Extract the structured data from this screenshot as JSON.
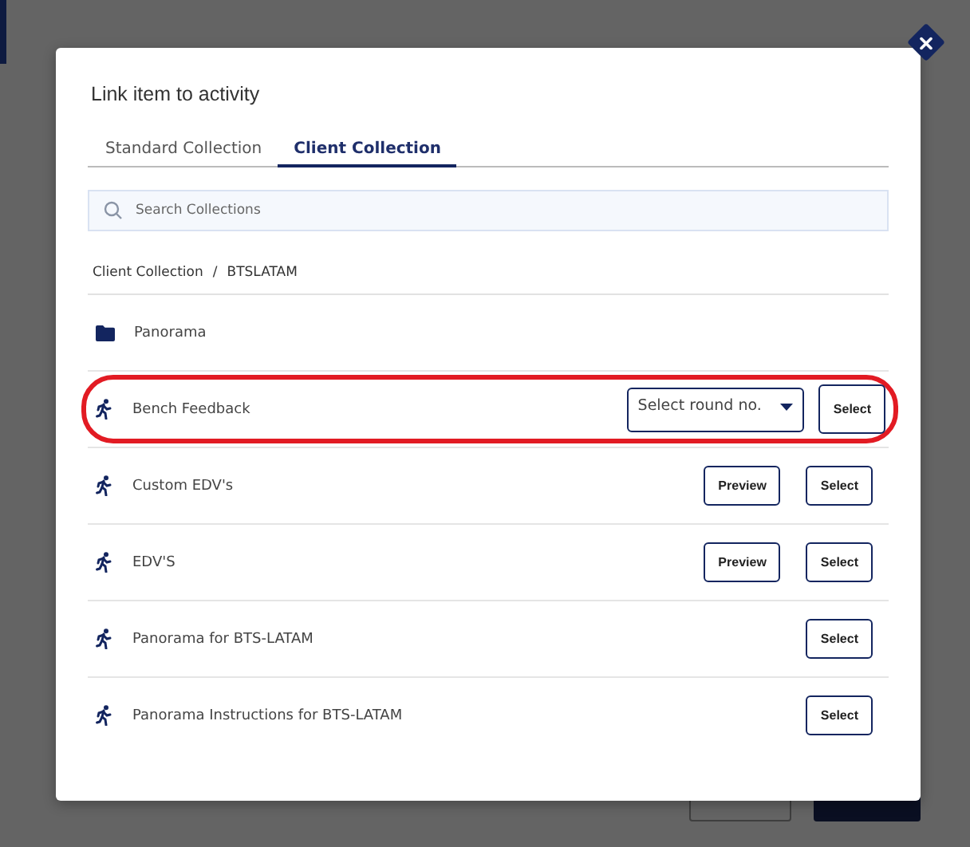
{
  "dialog": {
    "title": "Link item to activity"
  },
  "tabs": [
    {
      "label": "Standard Collection",
      "selected": false
    },
    {
      "label": "Client Collection",
      "selected": true
    }
  ],
  "search": {
    "placeholder": "Search Collections"
  },
  "breadcrumb": [
    "Client Collection",
    "BTSLATAM"
  ],
  "breadcrumb_separator": "/",
  "rows": [
    {
      "kind": "folder",
      "name": "Panorama",
      "highlighted": false
    },
    {
      "kind": "activity",
      "name": "Bench Feedback",
      "highlighted": true,
      "round_select": {
        "placeholder": "Select round no."
      },
      "buttons": [
        "Select"
      ]
    },
    {
      "kind": "activity",
      "name": "Custom EDV's",
      "highlighted": false,
      "buttons": [
        "Preview",
        "Select"
      ]
    },
    {
      "kind": "activity",
      "name": "EDV'S",
      "highlighted": false,
      "buttons": [
        "Preview",
        "Select"
      ]
    },
    {
      "kind": "activity",
      "name": "Panorama for BTS-LATAM",
      "highlighted": false,
      "buttons": [
        "Select"
      ]
    },
    {
      "kind": "activity",
      "name": "Panorama Instructions for BTS-LATAM",
      "highlighted": false,
      "buttons": [
        "Select"
      ]
    }
  ]
}
